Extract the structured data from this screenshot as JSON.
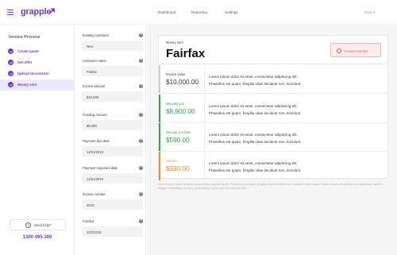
{
  "header": {
    "logo": "grapple",
    "nav": [
      "Dashboard",
      "Reporting",
      "Settings"
    ],
    "start_link": "Start it"
  },
  "sidebar": {
    "title": "Invoice Process",
    "steps": [
      {
        "label": "Create quote"
      },
      {
        "label": "Get offer"
      },
      {
        "label": "Upload documents"
      },
      {
        "label": "Money sent",
        "active": true
      }
    ],
    "help": "Need help?",
    "phone": "1300 495 300"
  },
  "form": {
    "fields": [
      {
        "label": "Existing customer",
        "value": "New"
      },
      {
        "label": "Customer name",
        "value": "Fairfax"
      },
      {
        "label": "Invoice amount",
        "value": "$10,000"
      },
      {
        "label": "Funding  Amount",
        "value": "$9,290"
      },
      {
        "label": "Payment due date",
        "value": "12/21/2018"
      },
      {
        "label": "Payment expected date",
        "value": "12/01/2019"
      },
      {
        "label": "Invoice number",
        "value": "0043"
      },
      {
        "label": "Funded",
        "value": "22/2/2019"
      }
    ]
  },
  "main": {
    "money_sent_label": "Money sent",
    "company": "Fairfax",
    "overdue": "Invoice overdue",
    "rows": [
      {
        "label": "Invoice value",
        "value": "$10,000.00",
        "line1": "Lorem ipsum dolor sit amet, consectetur adipiscing elit.",
        "line2": "Phasellus est quam, fringilla vitae tincidunt non, tincidunt."
      },
      {
        "label": "We paid you",
        "value": "$8,900.00",
        "line1": "Lorem ipsum dolor sit amet, consectetur adipiscing elit.",
        "line2": "Phasellus est quam, fringilla vitae tincidunt non, tincidunt."
      },
      {
        "label": "We pay you later",
        "value": "$590.00",
        "line1": "Lorem ipsum dolor sit amet, consectetur adipiscing elit.",
        "line2": "Phasellus est quam, fringilla vitae tincidunt non, tincidunt."
      },
      {
        "label": "Our fee",
        "value": "$390.00",
        "line1": "Lorem ipsum dolor sit amet, consectetur adipiscing elit.",
        "line2": "Phasellus est quam, fringilla vitae tincidunt non, tincidunt."
      }
    ],
    "footnote": "Lorem ipsum dolor sit amet, consectetur adipiscing elit. Phasellus est quam, fringilla vitae tincidunt non, tincidunt vitae neque. Etiam rutrum nisl pretium est accumsan laoreet. Integer consectetur tempor, pellentesque justo quis est, lobortis odio."
  },
  "colors": {
    "brand": "#6a3bd8",
    "green": "#2ea84a",
    "orange": "#f08a24",
    "danger": "#e05a5a"
  }
}
